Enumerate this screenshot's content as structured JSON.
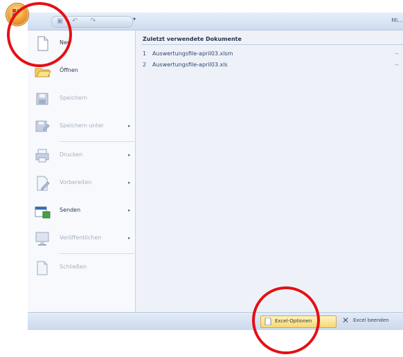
{
  "window": {
    "title": "Mi..."
  },
  "quick_access": {
    "save_icon": "save-icon",
    "undo_icon": "undo-icon",
    "redo_icon": "redo-icon",
    "more": "▾"
  },
  "office_button": {
    "icon": "office-logo-icon"
  },
  "menu": {
    "items": [
      {
        "label": "Neu",
        "icon": "new-document-icon",
        "enabled": true,
        "submenu": false
      },
      {
        "label": "Öffnen",
        "icon": "open-folder-icon",
        "enabled": true,
        "submenu": false
      },
      {
        "label": "Speichern",
        "icon": "save-icon",
        "enabled": false,
        "submenu": false
      },
      {
        "label": "Speichern unter",
        "icon": "save-as-icon",
        "enabled": false,
        "submenu": true
      },
      {
        "label": "Drucken",
        "icon": "print-icon",
        "enabled": false,
        "submenu": true
      },
      {
        "label": "Vorbereiten",
        "icon": "prepare-icon",
        "enabled": false,
        "submenu": true
      },
      {
        "label": "Senden",
        "icon": "send-icon",
        "enabled": true,
        "submenu": true
      },
      {
        "label": "Veröffentlichen",
        "icon": "publish-icon",
        "enabled": false,
        "submenu": true
      },
      {
        "label": "Schließen",
        "icon": "close-document-icon",
        "enabled": false,
        "submenu": false
      }
    ]
  },
  "recent": {
    "title": "Zuletzt verwendete Dokumente",
    "documents": [
      {
        "number": "1",
        "name": "Auswertungsfile-april03.xlsm"
      },
      {
        "number": "2",
        "name": "Auswertungsfile-april03.xls"
      }
    ]
  },
  "footer": {
    "options_label": "Excel-Optionen",
    "exit_label": "Excel beenden"
  },
  "annotation_color": "#e50f14"
}
